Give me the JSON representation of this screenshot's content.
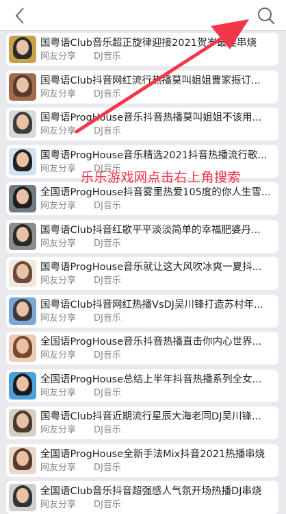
{
  "topbar": {
    "back_icon": "chevron-left-icon",
    "search_icon": "search-icon"
  },
  "colors": {
    "accent_red": "#f2374a",
    "background": "#e9e9ee",
    "meta_gray": "#888888"
  },
  "items": [
    {
      "title": "国粤语Club音乐超正旋律迎接2021贺岁最佳串烧",
      "source": "网友分享",
      "category": "DJ音乐",
      "thumb_colors": [
        "#c8a24a",
        "#2b2b2b"
      ]
    },
    {
      "title": "国粤语Club抖音网红流行热播莫叫姐姐曹家振订...",
      "source": "网友分享",
      "category": "DJ音乐",
      "thumb_colors": [
        "#a06a4c",
        "#5a3a2a"
      ]
    },
    {
      "title": "国粤语ProgHouse音乐抖音热播莫叫姐姐不该用...",
      "source": "网友分享",
      "category": "DJ音乐",
      "thumb_colors": [
        "#d9d9d9",
        "#3b3b3b"
      ]
    },
    {
      "title": "国粤语ProgHouse音乐精选2021抖音热播流行歌...",
      "source": "网友分享",
      "category": "DJ音乐",
      "thumb_colors": [
        "#cfe3f2",
        "#222222"
      ]
    },
    {
      "title": "全国语ProgHouse抖音雾里热爱105度的你人生雪...",
      "source": "网友分享",
      "category": "DJ音乐",
      "thumb_colors": [
        "#6e7a86",
        "#1e1e1e"
      ]
    },
    {
      "title": "国粤语Club抖音红歌平平淡淡简单的幸福肥婆丹...",
      "source": "网友分享",
      "category": "DJ音乐",
      "thumb_colors": [
        "#8c8c8c",
        "#2a2a2a"
      ]
    },
    {
      "title": "国粤语ProgHouse音乐就让这大风吹冰爽一夏抖...",
      "source": "网友分享",
      "category": "DJ音乐",
      "thumb_colors": [
        "#f1e7dc",
        "#6b4a3a"
      ]
    },
    {
      "title": "国粤语Club抖音网红热播VsDJ吴川锋打造苏村年...",
      "source": "网友分享",
      "category": "DJ音乐",
      "thumb_colors": [
        "#7aa7d8",
        "#3a3a3a"
      ]
    },
    {
      "title": "全国语ProgHouse音乐抖音热播直击你内心世界...",
      "source": "网友分享",
      "category": "DJ音乐",
      "thumb_colors": [
        "#e9cdb8",
        "#7a4a2e"
      ]
    },
    {
      "title": "全国语ProgHouse总结上半年抖音热播系列全女...",
      "source": "网友分享",
      "category": "DJ音乐",
      "thumb_colors": [
        "#4aa0d8",
        "#1a1a1a"
      ]
    },
    {
      "title": "国粤语Club抖音近期流行星辰大海老同DJ吴川锋...",
      "source": "网友分享",
      "category": "DJ音乐",
      "thumb_colors": [
        "#d6cfc4",
        "#4a3a30"
      ]
    },
    {
      "title": "全国语ProgHouse全新手法Mix抖音2021热播串烧",
      "source": "网友分享",
      "category": "DJ音乐",
      "thumb_colors": [
        "#e8d8cc",
        "#5a3a2a"
      ]
    },
    {
      "title": "全国语Club音乐抖音超强感人气氛开场热播DJ串烧",
      "source": "网友分享",
      "category": "DJ音乐",
      "thumb_colors": [
        "#cfcfcf",
        "#333333"
      ]
    }
  ],
  "overlay": {
    "text": "乐乐游戏网点击右上角搜索"
  }
}
